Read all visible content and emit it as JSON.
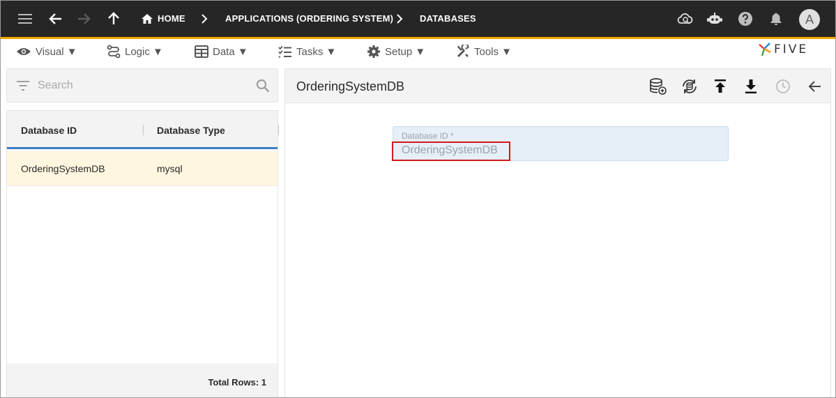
{
  "topbar": {
    "breadcrumb": [
      "HOME",
      "APPLICATIONS (ORDERING SYSTEM)",
      "DATABASES"
    ],
    "avatar_initial": "A"
  },
  "menu": [
    {
      "label": "Visual ▼",
      "icon": "eye-icon"
    },
    {
      "label": "Logic ▼",
      "icon": "flow-icon"
    },
    {
      "label": "Data ▼",
      "icon": "table-icon"
    },
    {
      "label": "Tasks ▼",
      "icon": "checklist-icon"
    },
    {
      "label": "Setup ▼",
      "icon": "gear-icon"
    },
    {
      "label": "Tools ▼",
      "icon": "tools-icon"
    }
  ],
  "logo_text": "FIVE",
  "search": {
    "placeholder": "Search"
  },
  "list": {
    "columns": [
      "Database ID",
      "Database Type"
    ],
    "rows": [
      [
        "OrderingSystemDB",
        "mysql"
      ]
    ],
    "footer": "Total Rows: 1"
  },
  "detail": {
    "title": "OrderingSystemDB",
    "field_label": "Database ID *",
    "field_value": "OrderingSystemDB"
  },
  "colors": {
    "topbar": "#262626",
    "accent": "#f2a900",
    "selection": "#fff6e0",
    "highlight": "#d0191f"
  }
}
